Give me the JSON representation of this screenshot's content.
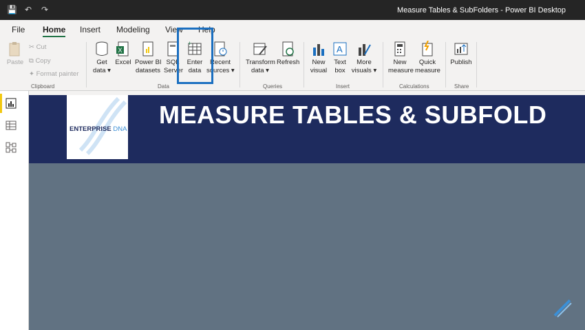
{
  "window": {
    "title": "Measure Tables & SubFolders - Power BI Desktop"
  },
  "tabs": [
    {
      "label": "File"
    },
    {
      "label": "Home"
    },
    {
      "label": "Insert"
    },
    {
      "label": "Modeling"
    },
    {
      "label": "View"
    },
    {
      "label": "Help"
    }
  ],
  "ribbon": {
    "clipboard": {
      "paste": "Paste",
      "cut": "Cut",
      "copy": "Copy",
      "format_painter": "Format painter",
      "group": "Clipboard"
    },
    "data": {
      "get_data": [
        "Get",
        "data"
      ],
      "excel": "Excel",
      "pbi_datasets": [
        "Power BI",
        "datasets"
      ],
      "sql_server": [
        "SQL",
        "Server"
      ],
      "enter_data": [
        "Enter",
        "data"
      ],
      "recent_sources": [
        "Recent",
        "sources"
      ],
      "group": "Data"
    },
    "queries": {
      "transform_data": [
        "Transform",
        "data"
      ],
      "refresh": "Refresh",
      "group": "Queries"
    },
    "insert": {
      "new_visual": [
        "New",
        "visual"
      ],
      "text_box": [
        "Text",
        "box"
      ],
      "more_visuals": [
        "More",
        "visuals"
      ],
      "group": "Insert"
    },
    "calculations": {
      "new_measure": [
        "New",
        "measure"
      ],
      "quick_measure": [
        "Quick",
        "measure"
      ],
      "group": "Calculations"
    },
    "share": {
      "publish": "Publish",
      "group": "Share"
    }
  },
  "report": {
    "headline": "MEASURE TABLES & SUBFOLD",
    "logo_text_main": "ENTERPRISE",
    "logo_text_accent": "DNA"
  },
  "colors": {
    "title_bar": "#252525",
    "banner": "#1e2b5e",
    "canvas": "#617282",
    "highlight": "#1a6fc0"
  }
}
